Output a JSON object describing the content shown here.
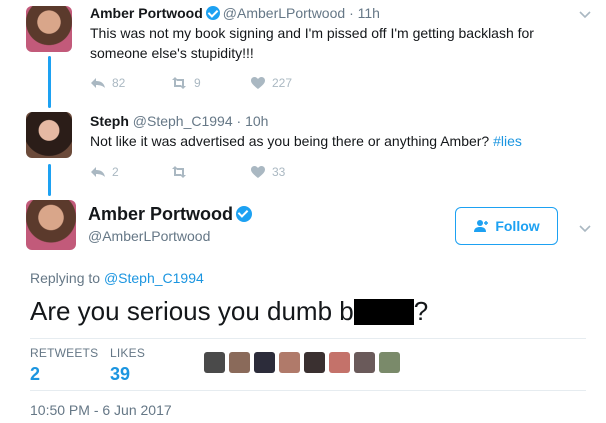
{
  "tweet1": {
    "name": "Amber Portwood",
    "handle": "@AmberLPortwood",
    "time": "· 11h",
    "text": "This was not my book signing and I'm pissed off I'm getting backlash for someone else's stupidity!!!",
    "replies": "82",
    "retweets": "9",
    "likes": "227"
  },
  "tweet2": {
    "name": "Steph",
    "handle": "@Steph_C1994",
    "time": "· 10h",
    "text": "Not like it was advertised as you being there or anything Amber?",
    "hashtag": "#lies",
    "replies": "2",
    "retweets": "",
    "likes": "33"
  },
  "main": {
    "name": "Amber Portwood",
    "handle": "@AmberLPortwood",
    "follow_label": "Follow",
    "replying_prefix": "Replying to",
    "replying_mention": "@Steph_C1994",
    "text_before": "Are you serious you dumb b",
    "text_after": "?",
    "retweets_label": "RETWEETS",
    "retweets_value": "2",
    "likes_label": "LIKES",
    "likes_value": "39",
    "timestamp": "10:50 PM - 6 Jun 2017"
  },
  "colors": {
    "accent": "#1da1f2",
    "link": "#1b95e0",
    "muted": "#657786"
  },
  "icons": [
    "verified-icon",
    "reply-icon",
    "retweet-icon",
    "heart-icon",
    "chevron-down-icon",
    "follow-person-icon"
  ]
}
